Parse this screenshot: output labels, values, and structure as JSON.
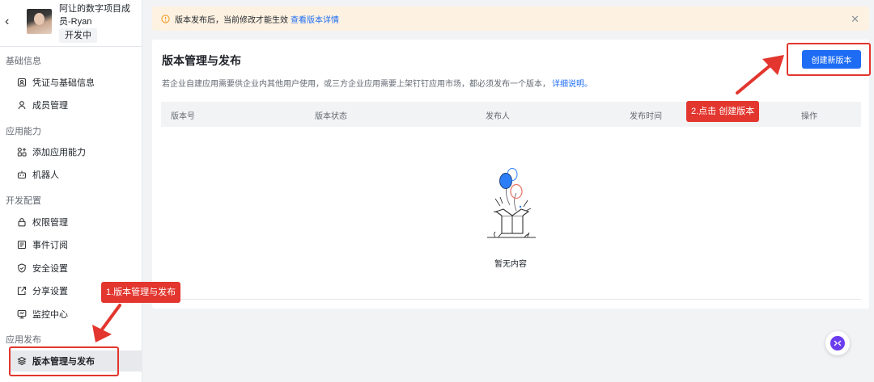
{
  "app": {
    "name": "阿让的数字项目成员-Ryan",
    "status_badge": "开发中"
  },
  "sidebar": {
    "sections": [
      {
        "title": "基础信息",
        "items": [
          {
            "label": "凭证与基础信息",
            "icon": "credential-icon"
          },
          {
            "label": "成员管理",
            "icon": "user-icon"
          }
        ]
      },
      {
        "title": "应用能力",
        "items": [
          {
            "label": "添加应用能力",
            "icon": "apps-add-icon"
          },
          {
            "label": "机器人",
            "icon": "robot-icon"
          }
        ]
      },
      {
        "title": "开发配置",
        "items": [
          {
            "label": "权限管理",
            "icon": "lock-icon"
          },
          {
            "label": "事件订阅",
            "icon": "subscription-icon"
          },
          {
            "label": "安全设置",
            "icon": "shield-icon"
          },
          {
            "label": "分享设置",
            "icon": "share-icon"
          },
          {
            "label": "监控中心",
            "icon": "monitor-icon"
          }
        ]
      },
      {
        "title": "应用发布",
        "items": [
          {
            "label": "版本管理与发布",
            "icon": "layers-icon",
            "active": true
          }
        ]
      }
    ]
  },
  "notice": {
    "text": "版本发布后，当前修改才能生效",
    "link": "查看版本详情"
  },
  "main": {
    "title": "版本管理与发布",
    "description": "若企业自建应用需要供企业内其他用户使用，或三方企业应用需要上架钉钉应用市场，都必须发布一个版本，",
    "description_link": "详细说明。",
    "create_button": "创建新版本",
    "columns": [
      "版本号",
      "版本状态",
      "发布人",
      "发布时间",
      "操作"
    ],
    "empty_text": "暂无内容"
  },
  "annotations": {
    "step1": "1.版本管理与发布",
    "step2": "2.点击 创建版本"
  },
  "colors": {
    "accent": "#1e6cf4",
    "annotation": "#e2362e",
    "notice_bg": "#fdf2e2"
  }
}
